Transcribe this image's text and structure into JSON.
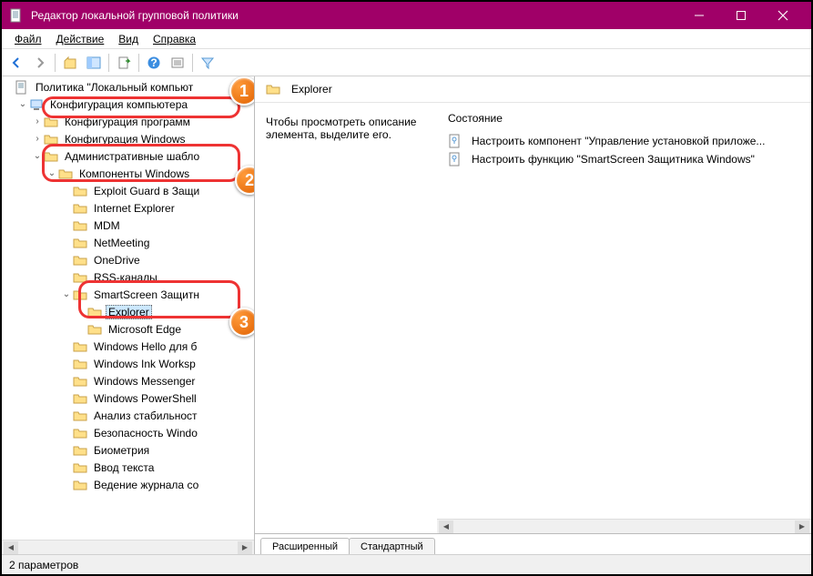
{
  "title": "Редактор локальной групповой политики",
  "menu": {
    "file": "Файл",
    "action": "Действие",
    "view": "Вид",
    "help": "Справка"
  },
  "tree": {
    "root": "Политика \"Локальный компьют",
    "comp_cfg": "Конфигурация компьютера",
    "prog_cfg": "Конфигурация программ",
    "win_cfg": "Конфигурация Windows",
    "admin_tpl": "Административные шабло",
    "win_comp": "Компоненты Windows",
    "items": [
      "Exploit Guard в Защи",
      "Internet Explorer",
      "MDM",
      "NetMeeting",
      "OneDrive",
      "RSS-каналы",
      "SmartScreen Защитн",
      "Explorer",
      "Microsoft Edge",
      "Windows Hello для б",
      "Windows Ink Worksp",
      "Windows Messenger",
      "Windows PowerShell",
      "Анализ стабильност",
      "Безопасность Windo",
      "Биометрия",
      "Ввод текста",
      "Ведение журнала со"
    ]
  },
  "right": {
    "heading": "Explorer",
    "desc": "Чтобы просмотреть описание элемента, выделите его.",
    "state_col": "Состояние",
    "rows": [
      "Настроить компонент \"Управление установкой приложе...",
      "Настроить функцию \"SmartScreen Защитника Windows\""
    ]
  },
  "tabs": {
    "ext": "Расширенный",
    "std": "Стандартный"
  },
  "status": "2 параметров",
  "badges": [
    "1",
    "2",
    "3"
  ]
}
